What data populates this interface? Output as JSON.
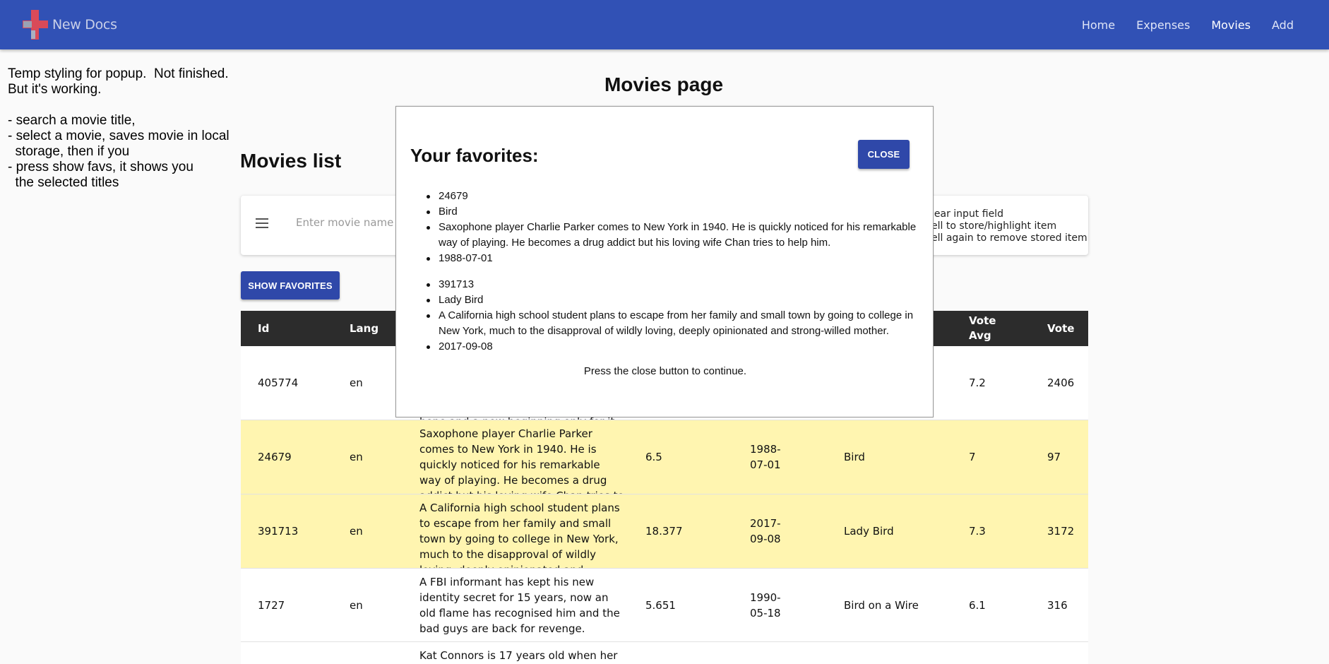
{
  "app": {
    "brand": "New Docs"
  },
  "nav": {
    "items": [
      "Home",
      "Expenses",
      "Movies",
      "Add"
    ],
    "active": "Movies"
  },
  "notes": {
    "text": "Temp styling for popup.  Not finished.\nBut it's working.\n\n- search a movie title,\n- select a movie, saves movie in local\n  storage, then if you\n- press show favs, it shows you\n  the selected titles"
  },
  "page": {
    "title": "Movies page",
    "section_title": "Movies list"
  },
  "search": {
    "placeholder": "Enter movie name",
    "hints": [
      "lear input field",
      "ell to store/highlight item",
      "ell again to remove stored item"
    ]
  },
  "buttons": {
    "show_favorites": "SHOW FAVORITES",
    "close": "CLOSE"
  },
  "table": {
    "headers": {
      "id": "Id",
      "lang": "Lang",
      "vote_avg": "Vote\nAvg",
      "vote": "Vote"
    },
    "rows": [
      {
        "id": "405774",
        "lang": "en",
        "overview": "hope and a new beginning only for it to",
        "popularity": "",
        "release": "",
        "title": "",
        "vote_avg": "7.2",
        "vote": "2406",
        "favorite": false
      },
      {
        "id": "24679",
        "lang": "en",
        "overview": "Saxophone player Charlie Parker comes to New York in 1940. He is quickly noticed for his remarkable way of playing. He becomes a drug addict but his loving wife Chan tries to help him.",
        "popularity": "6.5",
        "release": "1988-\n07-01",
        "title": "Bird",
        "vote_avg": "7",
        "vote": "97",
        "favorite": true
      },
      {
        "id": "391713",
        "lang": "en",
        "overview": "A California high school student plans to escape from her family and small town by going to college in New York, much to the disapproval of wildly loving, deeply opinionated and strong-willed mother.",
        "popularity": "18.377",
        "release": "2017-\n09-08",
        "title": "Lady Bird",
        "vote_avg": "7.3",
        "vote": "3172",
        "favorite": true
      },
      {
        "id": "1727",
        "lang": "en",
        "overview": "A FBI informant has kept his new identity secret for 15 years, now an old flame has recognised him and the bad guys are back for revenge.",
        "popularity": "5.651",
        "release": "1990-\n05-18",
        "title": "Bird on a Wire",
        "vote_avg": "6.1",
        "vote": "316",
        "favorite": false
      },
      {
        "id": "",
        "lang": "",
        "overview": "Kat Connors is 17 years old when her",
        "popularity": "",
        "release": "",
        "title": "",
        "vote_avg": "",
        "vote": "",
        "favorite": false
      }
    ]
  },
  "modal": {
    "title": "Your favorites:",
    "favorites": [
      {
        "id": "24679",
        "title": "Bird",
        "overview": "Saxophone player Charlie Parker comes to New York in 1940. He is quickly noticed for his remarkable way of playing. He becomes a drug addict but his loving wife Chan tries to help him.",
        "release": "1988-07-01"
      },
      {
        "id": "391713",
        "title": "Lady Bird",
        "overview": "A California high school student plans to escape from her family and small town by going to college in New York, much to the disapproval of wildly loving, deeply opinionated and strong-willed mother.",
        "release": "2017-09-08"
      }
    ],
    "footer": "Press the close button to continue."
  }
}
